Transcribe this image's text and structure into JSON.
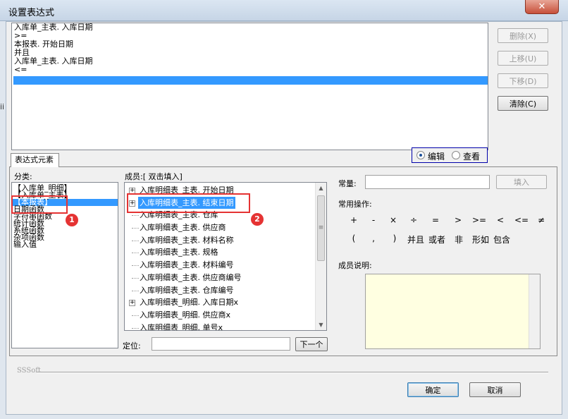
{
  "window": {
    "title": "设置表达式",
    "close_glyph": "✕"
  },
  "expression": {
    "lines": [
      "入库单_主表. 入库日期",
      ">=",
      "本报表. 开始日期",
      "并且",
      "入库单_主表. 入库日期",
      "<="
    ]
  },
  "side_buttons": {
    "delete": "删除(X)",
    "move_up": "上移(U)",
    "move_down": "下移(D)",
    "clear": "清除(C)"
  },
  "tab_label": "表达式元素",
  "mode": {
    "edit_label": "编辑",
    "view_label": "查看",
    "selected": "编辑"
  },
  "category": {
    "label": "分类:",
    "items": [
      "【入库单_明细】",
      "【入库单_主表】",
      "【本报表】",
      "日期函数",
      "字符串函数",
      "统计函数",
      "系统函数",
      "杂项函数",
      "输入值"
    ],
    "selected_index": 2
  },
  "members": {
    "label": "成员:[ 双击填入]",
    "items": [
      {
        "text": "入库明细表_主表. 开始日期",
        "expandable": true
      },
      {
        "text": "入库明细表_主表. 结束日期",
        "expandable": true,
        "selected": true
      },
      {
        "text": "入库明细表_主表. 仓库",
        "expandable": false
      },
      {
        "text": "入库明细表_主表. 供应商",
        "expandable": false
      },
      {
        "text": "入库明细表_主表. 材料名称",
        "expandable": false
      },
      {
        "text": "入库明细表_主表. 规格",
        "expandable": false
      },
      {
        "text": "入库明细表_主表. 材料编号",
        "expandable": false
      },
      {
        "text": "入库明细表_主表. 供应商编号",
        "expandable": false
      },
      {
        "text": "入库明细表_主表. 仓库编号",
        "expandable": false
      },
      {
        "text": "入库明细表_明细. 入库日期x",
        "expandable": true
      },
      {
        "text": "入库明细表_明细. 供应商x",
        "expandable": false
      },
      {
        "text": "入库明细表_明细. 单号x",
        "expandable": false
      }
    ]
  },
  "locate": {
    "label": "定位:",
    "value": "",
    "next_button": "下一个"
  },
  "constant": {
    "label": "常量:",
    "value": "",
    "fill_button": "填入"
  },
  "operations": {
    "label": "常用操作:",
    "row1": [
      "+",
      "-",
      "×",
      "÷",
      "=",
      ">",
      ">=",
      "<",
      "<=",
      "≠"
    ],
    "row2": [
      "(",
      ",",
      ")",
      "并且",
      "或者",
      "非",
      "形如",
      "包含"
    ]
  },
  "member_desc": {
    "label": "成员说明:",
    "value": ""
  },
  "brand": "SSSoft",
  "buttons": {
    "ok": "确定",
    "cancel": "取消"
  },
  "annotations": {
    "marker1": "1",
    "marker2": "2"
  },
  "background_edge_text": "ii"
}
